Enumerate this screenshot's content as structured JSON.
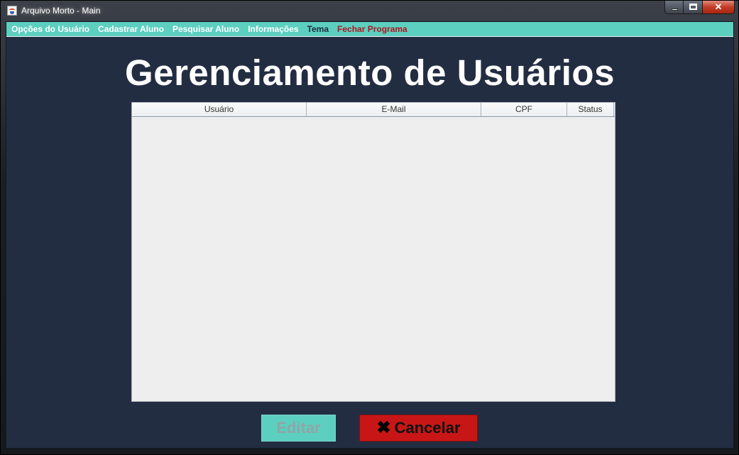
{
  "window": {
    "title": "Arquivo Morto - Main",
    "close_glyph": "✕"
  },
  "menu": [
    {
      "label": "Opções do Usuário"
    },
    {
      "label": "Cadastrar Aluno"
    },
    {
      "label": "Pesquisar Aluno"
    },
    {
      "label": "Informações"
    },
    {
      "label": "Tema"
    },
    {
      "label": "Fechar Programa"
    }
  ],
  "page": {
    "heading": "Gerenciamento de Usuários"
  },
  "table": {
    "columns": [
      "Usuário",
      "E-Mail",
      "CPF",
      "Status"
    ],
    "rows": []
  },
  "buttons": {
    "edit_label": "Editar",
    "cancel_label": "Cancelar",
    "cancel_icon_glyph": "✖"
  },
  "colors": {
    "accent": "#5ccfc0",
    "background": "#232d42",
    "danger": "#c81616",
    "menu_text": "#ffffff",
    "tema_text": "#1d2b3e",
    "fechar_text": "#b3141c"
  }
}
